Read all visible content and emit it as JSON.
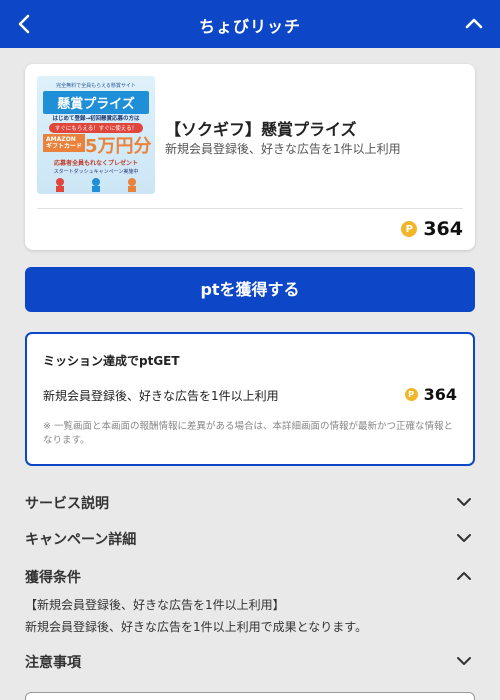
{
  "header": {
    "title": "ちょびリッチ",
    "back_icon": "chevron-left-icon",
    "collapse_icon": "chevron-up-icon"
  },
  "offer": {
    "title": "【ソクギフ】懸賞プライズ",
    "description": "新規会員登録後、好きな広告を1件以上利用",
    "points": "364",
    "coin_symbol": "P",
    "banner": {
      "top": "完全無料で全員もらえる懸賞サイト",
      "title": "懸賞プライズ",
      "sub1": "はじめて登録→初回懸賞応募の方は",
      "sub2": "すぐにもらえる！すぐに使える！",
      "amazon": "AMAZON\nギフトカード",
      "amount": "5万円分",
      "all": "応募者全員もれなくプレゼント",
      "dash": "スタートダッシュキャンペーン実施中"
    }
  },
  "cta": {
    "label": "ptを獲得する"
  },
  "mission": {
    "title": "ミッション達成でptGET",
    "item": "新規会員登録後、好きな広告を1件以上利用",
    "points": "364",
    "note": "※ 一覧画面と本画面の報酬情報に差異がある場合は、本詳細画面の情報が最新かつ正確な情報となります。"
  },
  "sections": [
    {
      "label": "サービス説明",
      "state": "collapsed"
    },
    {
      "label": "キャンペーン詳細",
      "state": "collapsed"
    },
    {
      "label": "獲得条件",
      "state": "expanded"
    },
    {
      "label": "注意事項",
      "state": "collapsed"
    }
  ],
  "conditions": {
    "line1": "【新規会員登録後、好きな広告を1件以上利用】",
    "line2": "新規会員登録後、好きな広告を1件以上利用で成果となります。"
  },
  "colors": {
    "primary": "#0d47c7",
    "coin": "#f2b62b",
    "background": "#e9e9e9"
  }
}
